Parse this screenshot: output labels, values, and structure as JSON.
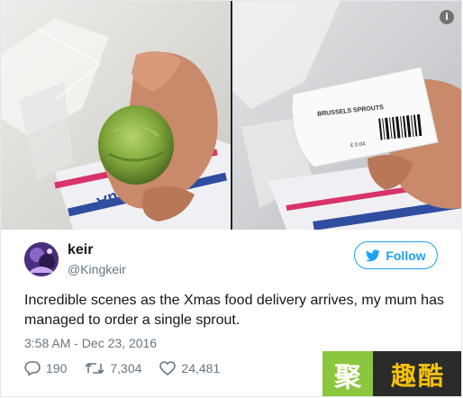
{
  "tweet": {
    "user": {
      "name": "keir",
      "handle": "@Kingkeir"
    },
    "follow_label": "Follow",
    "text": "Incredible scenes as the Xmas food delivery arrives, my mum has managed to order a single sprout.",
    "timestamp": "3:58 AM - Dec 23, 2016",
    "stats": {
      "replies": "190",
      "retweets": "7,304",
      "likes": "24,481"
    },
    "media": {
      "label_text": "BRUSSELS SPROUTS",
      "price_text": "£ 0.04",
      "bag_brand": "Andrex"
    }
  },
  "icons": {
    "info": "info-icon",
    "follow": "twitter-bird-icon",
    "reply": "reply-icon",
    "retweet": "retweet-icon",
    "like": "heart-icon"
  },
  "watermark": {
    "left_text": "聚",
    "right_text": "趣酷"
  },
  "colors": {
    "accent": "#1da1f2",
    "secondary_text": "#657786",
    "watermark_green": "#8cc63f",
    "watermark_yellow": "#f2c10e"
  }
}
